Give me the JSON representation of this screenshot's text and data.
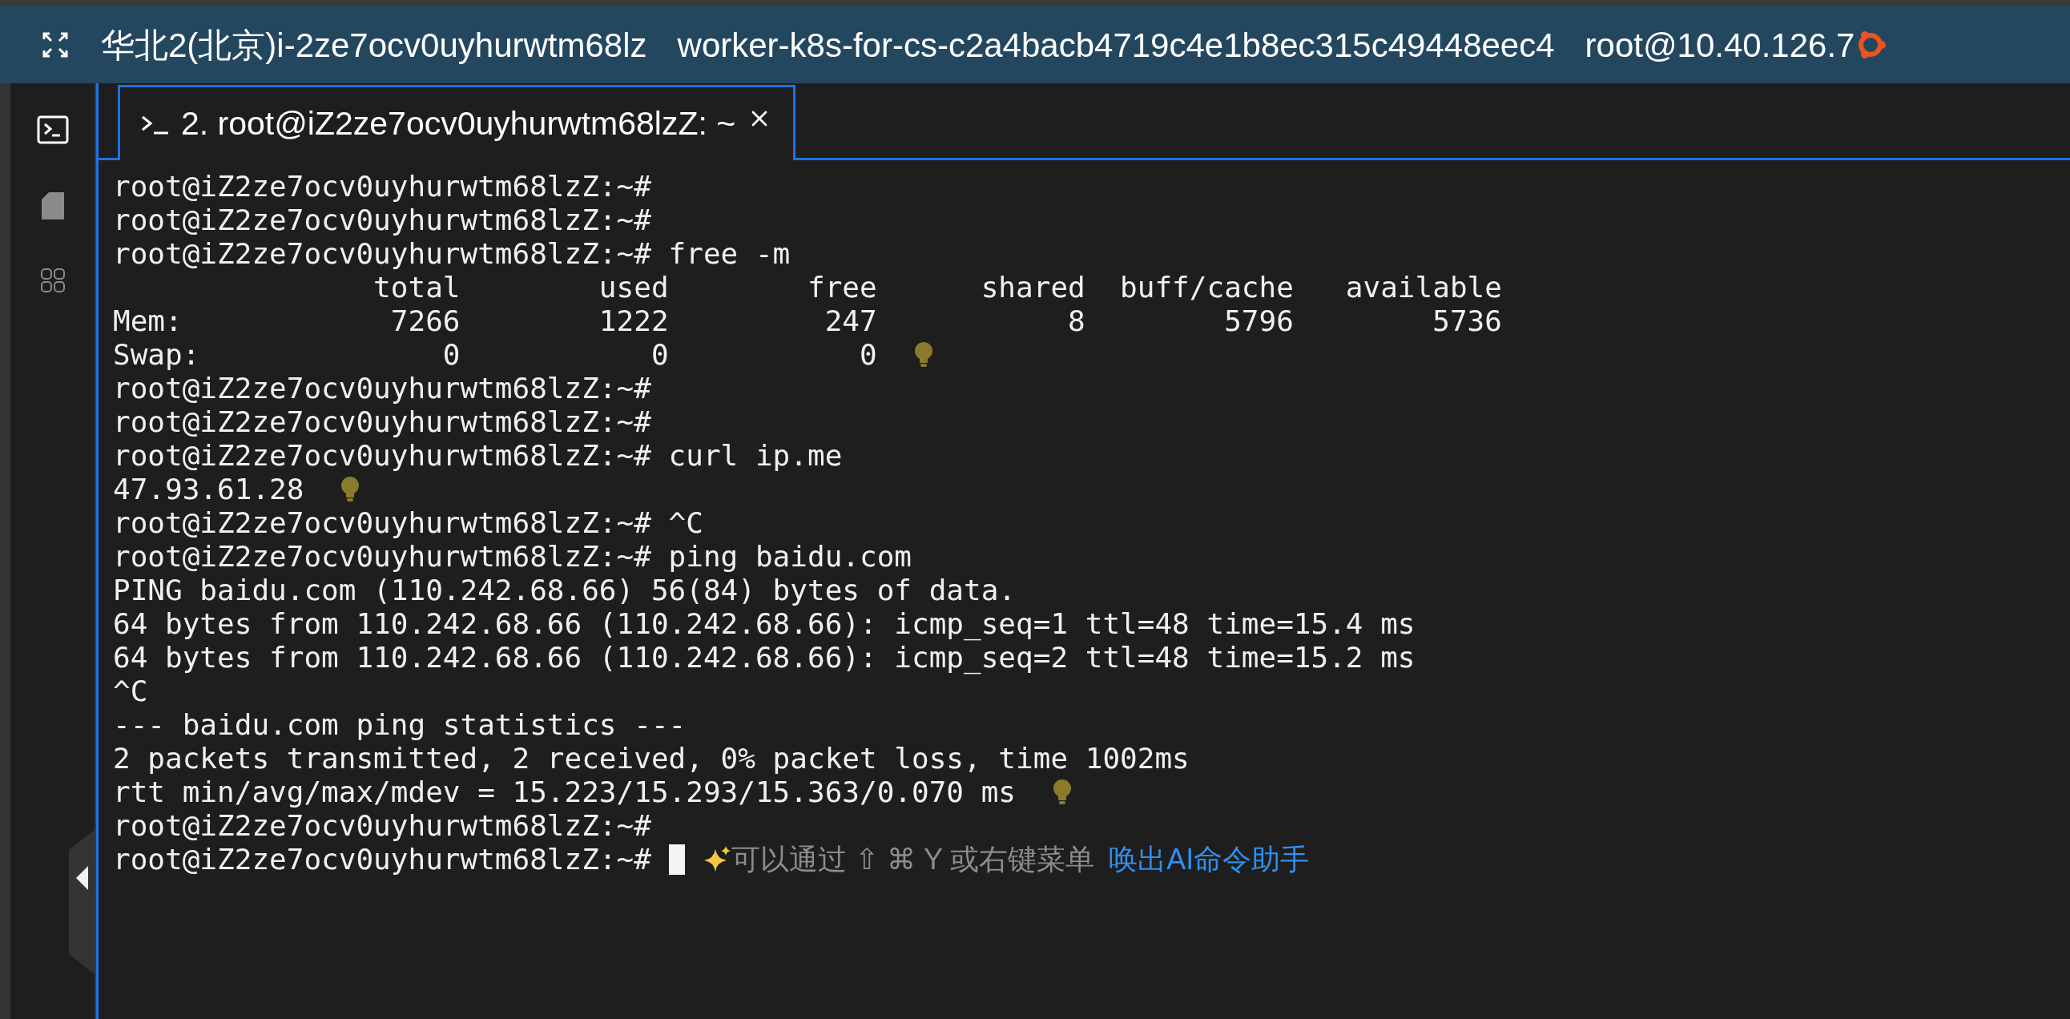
{
  "top_bar": {
    "region": "华北2(北京)i-2ze7ocv0uyhurwtm68lz",
    "worker": "worker-k8s-for-cs-c2a4bacb4719c4e1b8ec315c49448eec4",
    "login": "root@10.40.126.7"
  },
  "sidebar": {
    "items": [
      {
        "kind": "terminal",
        "selected": true
      },
      {
        "kind": "file",
        "selected": false
      },
      {
        "kind": "grid",
        "selected": false
      }
    ]
  },
  "tabs": [
    {
      "label": "2. root@iZ2ze7ocv0uyhurwtm68lzZ: ~",
      "selected": true
    }
  ],
  "terminal": {
    "lines": [
      {
        "text": "root@iZ2ze7ocv0uyhurwtm68lzZ:~#",
        "bulb": false
      },
      {
        "text": "root@iZ2ze7ocv0uyhurwtm68lzZ:~#",
        "bulb": false
      },
      {
        "text": "root@iZ2ze7ocv0uyhurwtm68lzZ:~# free -m",
        "bulb": false
      },
      {
        "text": "               total        used        free      shared  buff/cache   available",
        "bulb": false
      },
      {
        "text": "Mem:            7266        1222         247           8        5796        5736",
        "bulb": false
      },
      {
        "text": "Swap:              0           0           0",
        "bulb": true
      },
      {
        "text": "root@iZ2ze7ocv0uyhurwtm68lzZ:~#",
        "bulb": false
      },
      {
        "text": "root@iZ2ze7ocv0uyhurwtm68lzZ:~#",
        "bulb": false
      },
      {
        "text": "root@iZ2ze7ocv0uyhurwtm68lzZ:~# curl ip.me",
        "bulb": false
      },
      {
        "text": "47.93.61.28",
        "bulb": true
      },
      {
        "text": "root@iZ2ze7ocv0uyhurwtm68lzZ:~# ^C",
        "bulb": false
      },
      {
        "text": "root@iZ2ze7ocv0uyhurwtm68lzZ:~# ping baidu.com",
        "bulb": false
      },
      {
        "text": "PING baidu.com (110.242.68.66) 56(84) bytes of data.",
        "bulb": false
      },
      {
        "text": "64 bytes from 110.242.68.66 (110.242.68.66): icmp_seq=1 ttl=48 time=15.4 ms",
        "bulb": false
      },
      {
        "text": "64 bytes from 110.242.68.66 (110.242.68.66): icmp_seq=2 ttl=48 time=15.2 ms",
        "bulb": false
      },
      {
        "text": "^C",
        "bulb": false
      },
      {
        "text": "--- baidu.com ping statistics ---",
        "bulb": false
      },
      {
        "text": "2 packets transmitted, 2 received, 0% packet loss, time 1002ms",
        "bulb": false
      },
      {
        "text": "rtt min/avg/max/mdev = 15.223/15.293/15.363/0.070 ms",
        "bulb": true
      },
      {
        "text": "root@iZ2ze7ocv0uyhurwtm68lzZ:~#",
        "bulb": false
      }
    ],
    "prompt": "root@iZ2ze7ocv0uyhurwtm68lzZ:~#",
    "hint": "可以通过 ⇧ ⌘ Y 或右键菜单",
    "hint_link": "唤出AI命令助手"
  }
}
